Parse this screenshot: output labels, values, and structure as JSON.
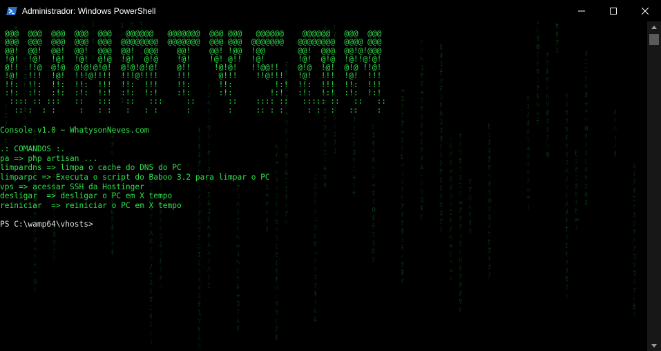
{
  "window": {
    "title": "Administrador: Windows PowerShell",
    "icon": "powershell-icon",
    "controls": [
      "minimize-icon",
      "maximize-icon",
      "close-icon"
    ]
  },
  "banner": [
    " @@@  @@@  @@@  @@@  @@@   @@@@@@   @@@@@@@  @@@ @@@   @@@@@@    @@@@@@   @@@  @@@",
    " @@@  @@@  @@@  @@@  @@@  @@@@@@@@  @@@@@@@  @@@ @@@  @@@@@@@   @@@@@@@@  @@@@ @@@",
    " @@!  @@!  @@!  @@!  @@@  @@!  @@@    @@!    @@! !@@  !@@       @@!  @@@  @@!@!@@@",
    " !@!  !@!  !@!  !@!  @!@  !@!  @!@    !@!    !@! @!!  !@!       !@!  @!@  !@!!@!@!",
    " @!!  !!@  @!@  @!@!@!@!  @!@!@!@!    @!!     !@!@!   !!@@!!    @!@  !@!  @!@ !!@!",
    " !@!  !!!  !@!  !!!@!!!!  !!!@!!!!    !!!      @!!!    !!@!!!   !@!  !!!  !@!  !!!",
    " !!:  !!:  !!:  !!:  !!!  !!:  !!!    !!:      !!:         !:!  !!:  !!!  !!:  !!!",
    " :!:  :!:  :!:  :!:  !:!  :!:  !:!    :!:      :!:        !:!   :!:  !:!  :!:  !:!",
    "  :::: :: :::   ::   :::   ::   :::     ::       ::    :::: ::   ::::: ::   ::   ::",
    "   :: :  : :     :   : :   :   : :      :        :     :: : :     : :  :   ::    :"
  ],
  "version_line": "Console v1.0 ~ WhatysonNeves.com",
  "commands_header": ".: COMANDOS :.",
  "commands": [
    "pa => php artisan ...",
    "limpardns => limpa o cache do DNS do PC",
    "limparpc => Executa o script do Baboo 3.2 para limpar o PC",
    "vps => acessar SSH da Hostinger",
    "desligar  => desligar o PC em X tempo",
    "reiniciar  => reiniciar o PC em X tempo"
  ],
  "prompt": "PS C:\\wamp64\\vhosts>",
  "colors": {
    "background": "#000000",
    "text_green": "#2fe04a",
    "rain_green": "#0e4a18",
    "prompt_text": "#dfe3df",
    "scrollbar_track": "#171717",
    "scrollbar_thumb": "#5a5a5a"
  }
}
